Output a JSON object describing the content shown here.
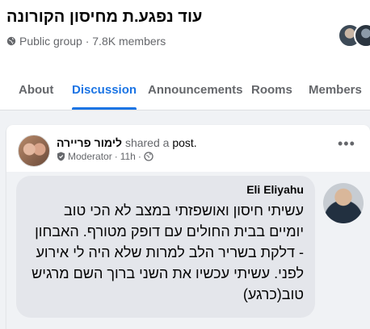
{
  "group": {
    "title": "עוד נפגע.ת מחיסון הקורונה",
    "meta": "Public group · 7.8K members"
  },
  "tabs": [
    {
      "label": "About",
      "active": false
    },
    {
      "label": "Discussion",
      "active": true
    },
    {
      "label": "Announcements",
      "active": false
    },
    {
      "label": "Rooms",
      "active": false
    },
    {
      "label": "Members",
      "active": false
    }
  ],
  "post": {
    "author": "לימור פריירה",
    "shared_text": "shared a",
    "post_link": "post.",
    "role": "Moderator",
    "time": "11h",
    "more_label": "•••"
  },
  "shared_comment": {
    "name": "Eli Eliyahu",
    "text": "עשיתי חיסון ואושפזתי במצב לא הכי טוב יומיים בבית החולים עם דופק מטורף. האבחון - דלקת בשריר הלב למרות שלא היה לי אירוע לפני. עשיתי עכשיו את השני ברוך השם מרגיש טוב(כרגע)"
  },
  "colors": {
    "accent": "#1b74e4",
    "secondary_text": "#65676b",
    "page_bg": "#f0f2f5"
  },
  "icons": {
    "globe": "globe-icon",
    "shield": "moderator-shield-icon",
    "public": "public-globe-icon",
    "more": "more-horizontal-icon"
  }
}
